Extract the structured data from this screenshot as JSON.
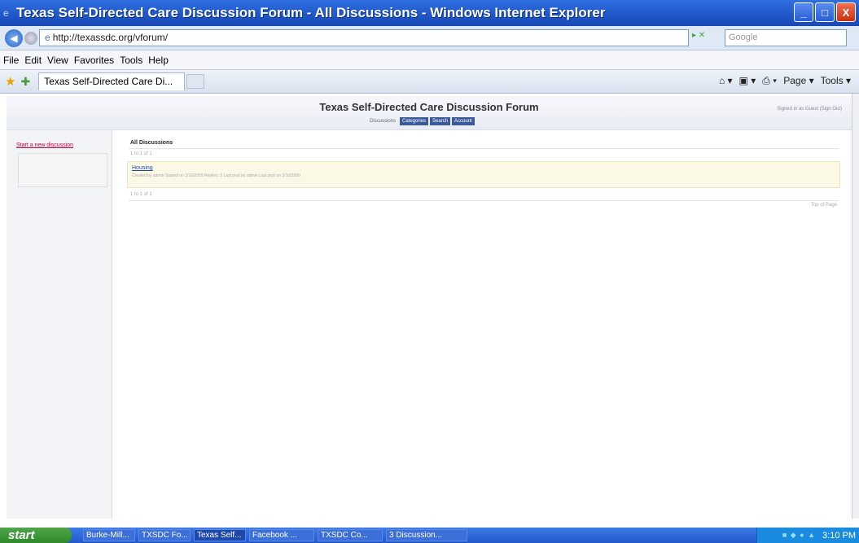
{
  "window": {
    "title": "Texas Self-Directed Care Discussion Forum - All Discussions - Windows Internet Explorer",
    "minimize_glyph": "_",
    "maximize_glyph": "□",
    "close_glyph": "X"
  },
  "addressbar": {
    "url": "http://texassdc.org/vforum/",
    "search_placeholder": "Google"
  },
  "menu": [
    "File",
    "Edit",
    "View",
    "Favorites",
    "Tools",
    "Help"
  ],
  "tab": {
    "label": "Texas Self-Directed Care Di..."
  },
  "ie_tools": {
    "page_label": "Page ▾",
    "tools_label": "Tools ▾"
  },
  "forum": {
    "title": "Texas Self-Directed Care Discussion Forum",
    "nav_label": "Discussions",
    "nav_buttons": [
      "Categories",
      "Search",
      "Account"
    ],
    "signin_text": "Signed in as Guest (Sign Out)",
    "start_link": "Start a new discussion",
    "all_discussions": "All Discussions",
    "page_info_top": "1 to 1 of 1",
    "page_info_bottom": "1 to 1 of 1",
    "discussion": {
      "title": "Housing",
      "meta": "Created by admin   Started on 3/10/2009   Replies: 0   Last post by admin   Last post on 3/10/2009"
    },
    "top_of_page": "Top of Page"
  },
  "taskbar": {
    "start_label": "start",
    "items": [
      "Burke-Mill...",
      "TXSDC Fo...",
      "Texas Self...",
      "Facebook ...",
      "TXSDC Co...",
      "3 Discussion..."
    ],
    "active_index": 2,
    "clock": "3:10 PM"
  }
}
